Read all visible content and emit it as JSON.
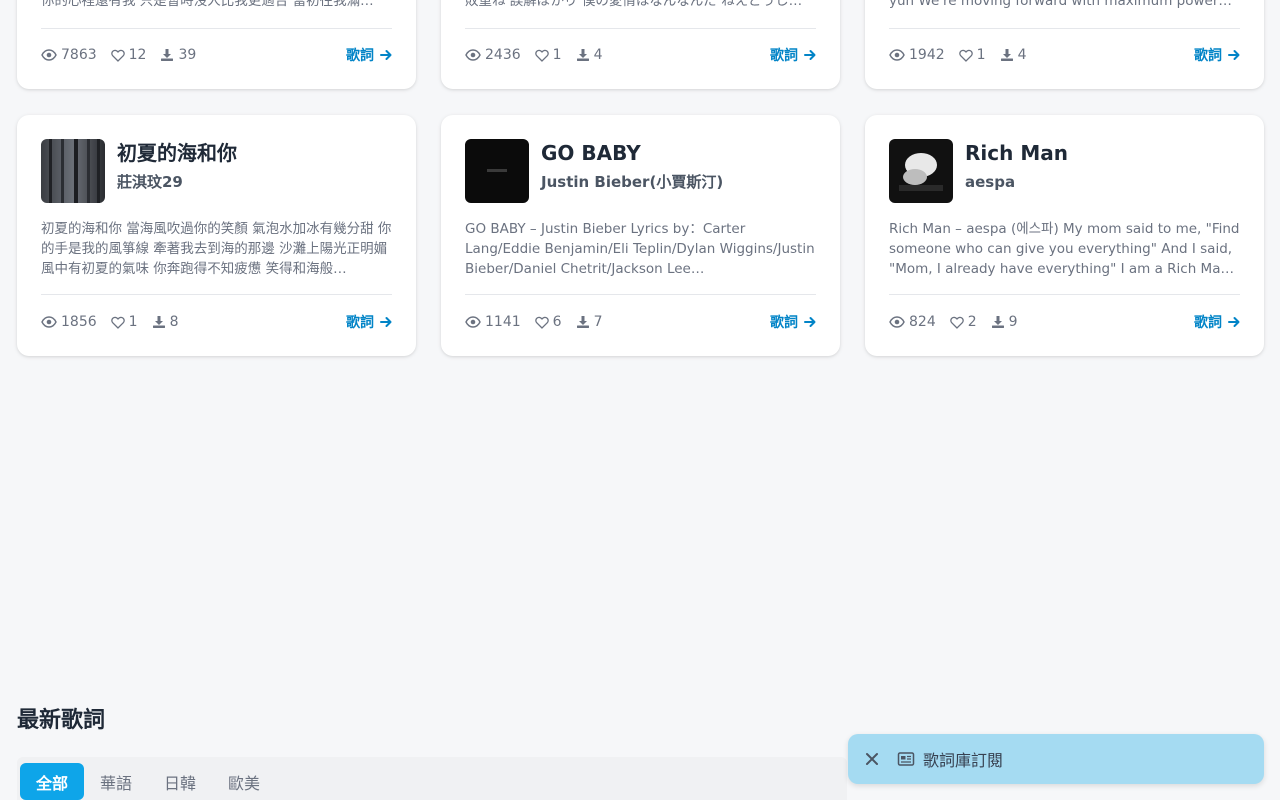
{
  "top_row": [
    {
      "lyric": "你的心裡還有我 只是暫時沒人比我更適合 當初往我滿…",
      "views": "7863",
      "likes": "12",
      "downloads": "39",
      "link_label": "歌詞"
    },
    {
      "lyric": "敗重ね 誤解ばかり 僕の愛情はなんなんだ ねえどうし…",
      "views": "2436",
      "likes": "1",
      "downloads": "4",
      "link_label": "歌詞"
    },
    {
      "lyric": "yuh We're moving forward with maximum power An…",
      "views": "1942",
      "likes": "1",
      "downloads": "4",
      "link_label": "歌詞"
    }
  ],
  "cards": [
    {
      "title": "初夏的海和你",
      "artist": "莊淇玟29",
      "lyric": "初夏的海和你 當海風吹過你的笑顏 氣泡水加冰有幾分甜 你的手是我的風箏線 牽著我去到海的那邊 沙灘上陽光正明媚 風中有初夏的氣味 你奔跑得不知疲憊 笑得和海般…",
      "views": "1856",
      "likes": "1",
      "downloads": "8",
      "link_label": "歌詞"
    },
    {
      "title": "GO BABY",
      "artist": "Justin Bieber(小賈斯汀)",
      "lyric": "GO BABY – Justin Bieber Lyrics by：Carter Lang/Eddie Benjamin/Eli Teplin/Dylan Wiggins/Justin Bieber/Daniel Chetrit/Jackson Lee…",
      "views": "1141",
      "likes": "6",
      "downloads": "7",
      "link_label": "歌詞"
    },
    {
      "title": "Rich Man",
      "artist": "aespa",
      "lyric": "Rich Man – aespa (에스파) My mom said to me, \"Find someone who can give you everything\" And I said, \"Mom, I already have everything\" I am a Rich Man I…",
      "views": "824",
      "likes": "2",
      "downloads": "9",
      "link_label": "歌詞"
    }
  ],
  "latest_section": {
    "title": "最新歌詞",
    "tabs": [
      "全部",
      "華語",
      "日韓",
      "歐美"
    ],
    "active_tab": 0
  },
  "toast": {
    "label": "歌詞庫訂閱"
  },
  "colors": {
    "accent": "#0ea5e9",
    "link": "#0284c7",
    "toast_bg": "#a5dbf2"
  }
}
